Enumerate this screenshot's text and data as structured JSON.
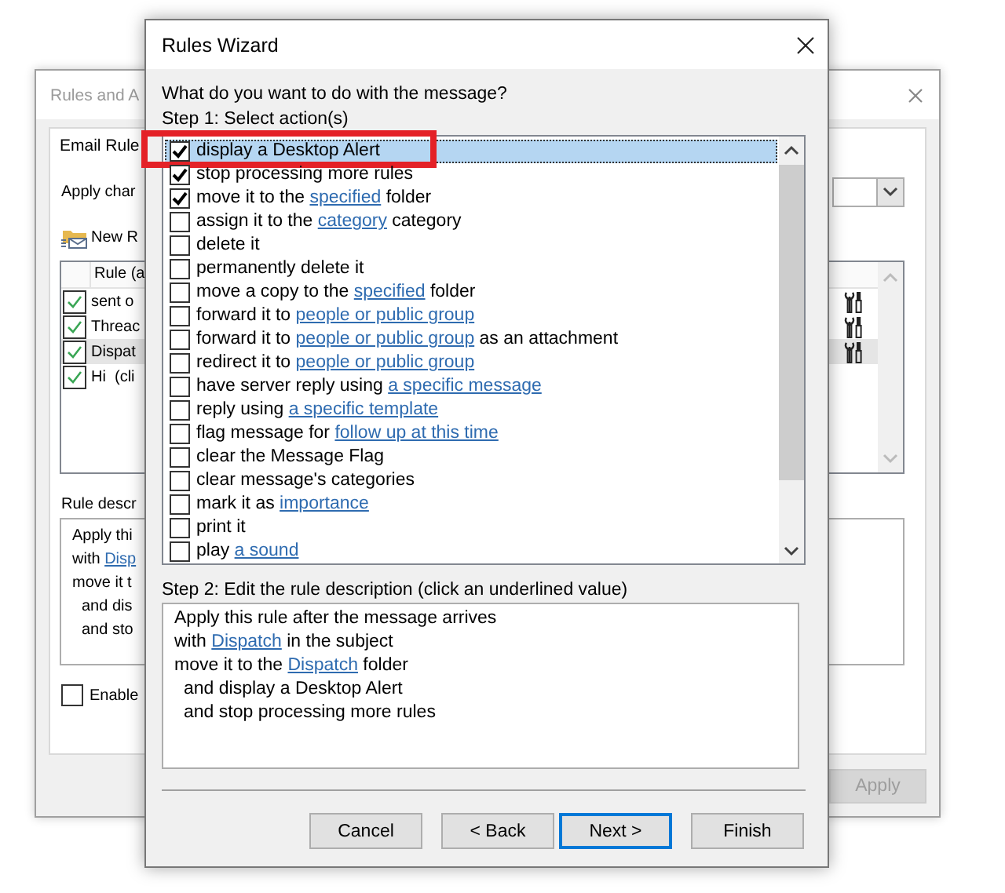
{
  "background_window": {
    "title": "Rules and A",
    "tabs": [
      {
        "label": "Email Rule",
        "selected": true
      }
    ],
    "apply_label": "Apply char",
    "new_rule": "New R",
    "rule_column": "Rule (a",
    "rules": [
      {
        "name": "sent o",
        "checked": true,
        "selected": false,
        "actions_icon": true
      },
      {
        "name": "Threac",
        "checked": true,
        "selected": false,
        "actions_icon": true
      },
      {
        "name": "Dispat",
        "checked": true,
        "selected": true,
        "actions_icon": true
      },
      {
        "name": "Hi  (cli",
        "checked": true,
        "selected": false,
        "actions_icon": false
      }
    ],
    "description_label": "Rule descr",
    "description": [
      {
        "indent": false,
        "parts": [
          {
            "text": "Apply thi"
          }
        ]
      },
      {
        "indent": false,
        "parts": [
          {
            "text": "with "
          },
          {
            "text": "Disp",
            "link": true
          }
        ]
      },
      {
        "indent": false,
        "parts": [
          {
            "text": "move it t"
          }
        ]
      },
      {
        "indent": true,
        "parts": [
          {
            "text": "and dis"
          }
        ]
      },
      {
        "indent": true,
        "parts": [
          {
            "text": "and sto"
          }
        ]
      }
    ],
    "enable": {
      "label": "Enable",
      "checked": false
    },
    "apply_button": {
      "label": "Apply",
      "disabled": true
    }
  },
  "dialog": {
    "title": "Rules Wizard",
    "question": "What do you want to do with the message?",
    "step1": "Step 1: Select action(s)",
    "actions": [
      {
        "checked": true,
        "selected": true,
        "highlighted": true,
        "parts": [
          {
            "text": "display a Desktop Alert"
          }
        ]
      },
      {
        "checked": true,
        "selected": false,
        "highlighted": false,
        "parts": [
          {
            "text": "stop processing more rules"
          }
        ]
      },
      {
        "checked": true,
        "selected": false,
        "highlighted": false,
        "parts": [
          {
            "text": "move it to the "
          },
          {
            "text": "specified",
            "link": true
          },
          {
            "text": " folder"
          }
        ]
      },
      {
        "checked": false,
        "selected": false,
        "highlighted": false,
        "parts": [
          {
            "text": "assign it to the "
          },
          {
            "text": "category",
            "link": true
          },
          {
            "text": " category"
          }
        ]
      },
      {
        "checked": false,
        "selected": false,
        "highlighted": false,
        "parts": [
          {
            "text": "delete it"
          }
        ]
      },
      {
        "checked": false,
        "selected": false,
        "highlighted": false,
        "parts": [
          {
            "text": "permanently delete it"
          }
        ]
      },
      {
        "checked": false,
        "selected": false,
        "highlighted": false,
        "parts": [
          {
            "text": "move a copy to the "
          },
          {
            "text": "specified",
            "link": true
          },
          {
            "text": " folder"
          }
        ]
      },
      {
        "checked": false,
        "selected": false,
        "highlighted": false,
        "parts": [
          {
            "text": "forward it to "
          },
          {
            "text": "people or public group",
            "link": true
          }
        ]
      },
      {
        "checked": false,
        "selected": false,
        "highlighted": false,
        "parts": [
          {
            "text": "forward it to "
          },
          {
            "text": "people or public group",
            "link": true
          },
          {
            "text": " as an attachment"
          }
        ]
      },
      {
        "checked": false,
        "selected": false,
        "highlighted": false,
        "parts": [
          {
            "text": "redirect it to "
          },
          {
            "text": "people or public group",
            "link": true
          }
        ]
      },
      {
        "checked": false,
        "selected": false,
        "highlighted": false,
        "parts": [
          {
            "text": "have server reply using "
          },
          {
            "text": "a specific message",
            "link": true
          }
        ]
      },
      {
        "checked": false,
        "selected": false,
        "highlighted": false,
        "parts": [
          {
            "text": "reply using "
          },
          {
            "text": "a specific template",
            "link": true
          }
        ]
      },
      {
        "checked": false,
        "selected": false,
        "highlighted": false,
        "parts": [
          {
            "text": "flag message for "
          },
          {
            "text": "follow up at this time",
            "link": true
          }
        ]
      },
      {
        "checked": false,
        "selected": false,
        "highlighted": false,
        "parts": [
          {
            "text": "clear the Message Flag"
          }
        ]
      },
      {
        "checked": false,
        "selected": false,
        "highlighted": false,
        "parts": [
          {
            "text": "clear message's categories"
          }
        ]
      },
      {
        "checked": false,
        "selected": false,
        "highlighted": false,
        "parts": [
          {
            "text": "mark it as "
          },
          {
            "text": "importance",
            "link": true
          }
        ]
      },
      {
        "checked": false,
        "selected": false,
        "highlighted": false,
        "parts": [
          {
            "text": "print it"
          }
        ]
      },
      {
        "checked": false,
        "selected": false,
        "highlighted": false,
        "parts": [
          {
            "text": "play "
          },
          {
            "text": "a sound",
            "link": true
          }
        ]
      }
    ],
    "step2": "Step 2: Edit the rule description (click an underlined value)",
    "description": [
      {
        "indent": false,
        "parts": [
          {
            "text": "Apply this rule after the message arrives"
          }
        ]
      },
      {
        "indent": false,
        "parts": [
          {
            "text": "with "
          },
          {
            "text": "Dispatch",
            "link": true
          },
          {
            "text": " in the subject"
          }
        ]
      },
      {
        "indent": false,
        "parts": [
          {
            "text": "move it to the "
          },
          {
            "text": "Dispatch",
            "link": true
          },
          {
            "text": " folder"
          }
        ]
      },
      {
        "indent": true,
        "parts": [
          {
            "text": "and display a Desktop Alert"
          }
        ]
      },
      {
        "indent": true,
        "parts": [
          {
            "text": "and stop processing more rules"
          }
        ]
      }
    ],
    "buttons": [
      {
        "label": "Cancel",
        "default": false
      },
      {
        "label": "< Back",
        "default": false
      },
      {
        "label": "Next >",
        "default": true
      },
      {
        "label": "Finish",
        "default": false
      }
    ]
  }
}
